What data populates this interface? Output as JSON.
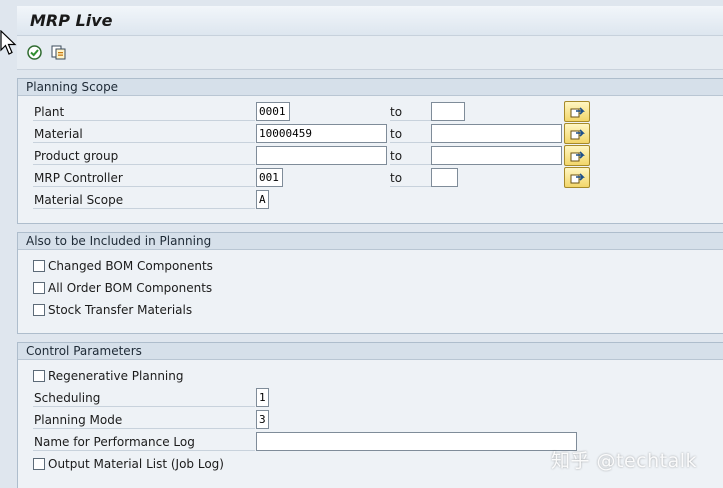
{
  "window": {
    "title": "MRP Live"
  },
  "toolbar": {
    "execute_icon": "execute-icon",
    "variant_icon": "get-variant-icon"
  },
  "planning_scope": {
    "header": "Planning Scope",
    "to_label": "to",
    "rows": [
      {
        "label": "Plant",
        "from": "0001",
        "to": ""
      },
      {
        "label": "Material",
        "from": "10000459",
        "to": ""
      },
      {
        "label": "Product group",
        "from": "",
        "to": ""
      },
      {
        "label": "MRP Controller",
        "from": "001",
        "to": ""
      },
      {
        "label": "Material Scope",
        "value": "A"
      }
    ]
  },
  "also_included": {
    "header": "Also to be Included in Planning",
    "options": [
      {
        "label": "Changed BOM Components",
        "checked": false
      },
      {
        "label": "All Order BOM Components",
        "checked": false
      },
      {
        "label": "Stock Transfer Materials",
        "checked": false
      }
    ]
  },
  "control_parameters": {
    "header": "Control Parameters",
    "regenerative": {
      "label": "Regenerative Planning",
      "checked": false
    },
    "scheduling": {
      "label": "Scheduling",
      "value": "1"
    },
    "planning_mode": {
      "label": "Planning Mode",
      "value": "3"
    },
    "perf_log": {
      "label": "Name for Performance Log",
      "value": ""
    },
    "output_list": {
      "label": "Output Material List (Job Log)",
      "checked": false
    }
  },
  "watermark": "知乎 @techtalk"
}
